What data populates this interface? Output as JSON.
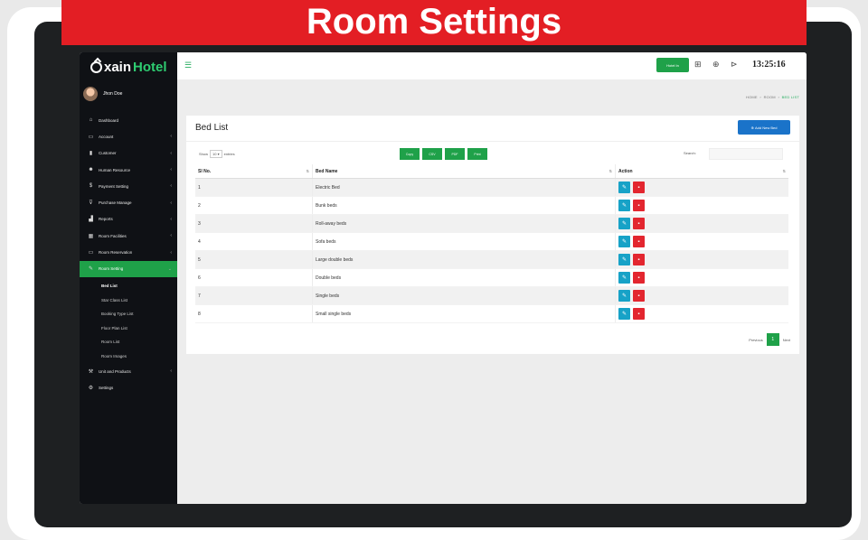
{
  "banner": {
    "title": "Room Settings"
  },
  "app": {
    "logo_prefix": "xain",
    "logo_accent": "Hotel",
    "user_name": "Jhon Doe",
    "brand_color": "#1fa149",
    "banner_color": "#e31e24"
  },
  "sidebar": {
    "items": [
      {
        "label": "Dashboard",
        "icon": "home-icon"
      },
      {
        "label": "Account",
        "icon": "wallet-icon"
      },
      {
        "label": "Customer",
        "icon": "user-icon"
      },
      {
        "label": "Human Resource",
        "icon": "people-icon"
      },
      {
        "label": "Payment Setting",
        "icon": "dollar-icon"
      },
      {
        "label": "Purchase Manage",
        "icon": "cart-icon"
      },
      {
        "label": "Reports",
        "icon": "chart-icon"
      },
      {
        "label": "Room Facilities",
        "icon": "grid-icon"
      },
      {
        "label": "Room Reservation",
        "icon": "ticket-icon"
      },
      {
        "label": "Room Setting",
        "icon": "wrench-icon"
      }
    ],
    "submenu": [
      "Bed List",
      "Star Class List",
      "Booking Type List",
      "Floor Plan List",
      "Room List",
      "Room Images"
    ],
    "bottom_items": [
      {
        "label": "Unit and Products",
        "icon": "tools-icon"
      },
      {
        "label": "Settings",
        "icon": "gear-icon"
      }
    ]
  },
  "topbar": {
    "hotel_button": "Hotel In",
    "clock": "13:25:16"
  },
  "breadcrumb": {
    "home": "HOME",
    "section": "ROOM",
    "current": "BED LIST"
  },
  "panel": {
    "title": "Bed List",
    "add_button": "Add New Bed",
    "show_label": "Show",
    "entries_value": "10",
    "entries_label": "entries",
    "export_buttons": [
      "Copy",
      "CSV",
      "PDF",
      "Print"
    ],
    "search_label": "Search:",
    "search_value": ""
  },
  "table": {
    "columns": [
      "Sl No.",
      "Bed Name",
      "Action"
    ],
    "rows": [
      {
        "no": "1",
        "name": "Electric Bed"
      },
      {
        "no": "2",
        "name": "Bunk beds"
      },
      {
        "no": "3",
        "name": "Roll-away beds"
      },
      {
        "no": "4",
        "name": "Sofa beds"
      },
      {
        "no": "5",
        "name": "Large double beds"
      },
      {
        "no": "6",
        "name": "Double beds"
      },
      {
        "no": "7",
        "name": "Single beds"
      },
      {
        "no": "8",
        "name": "Small single beds"
      }
    ]
  },
  "pagination": {
    "previous": "Previous",
    "current": "1",
    "next": "Next"
  }
}
